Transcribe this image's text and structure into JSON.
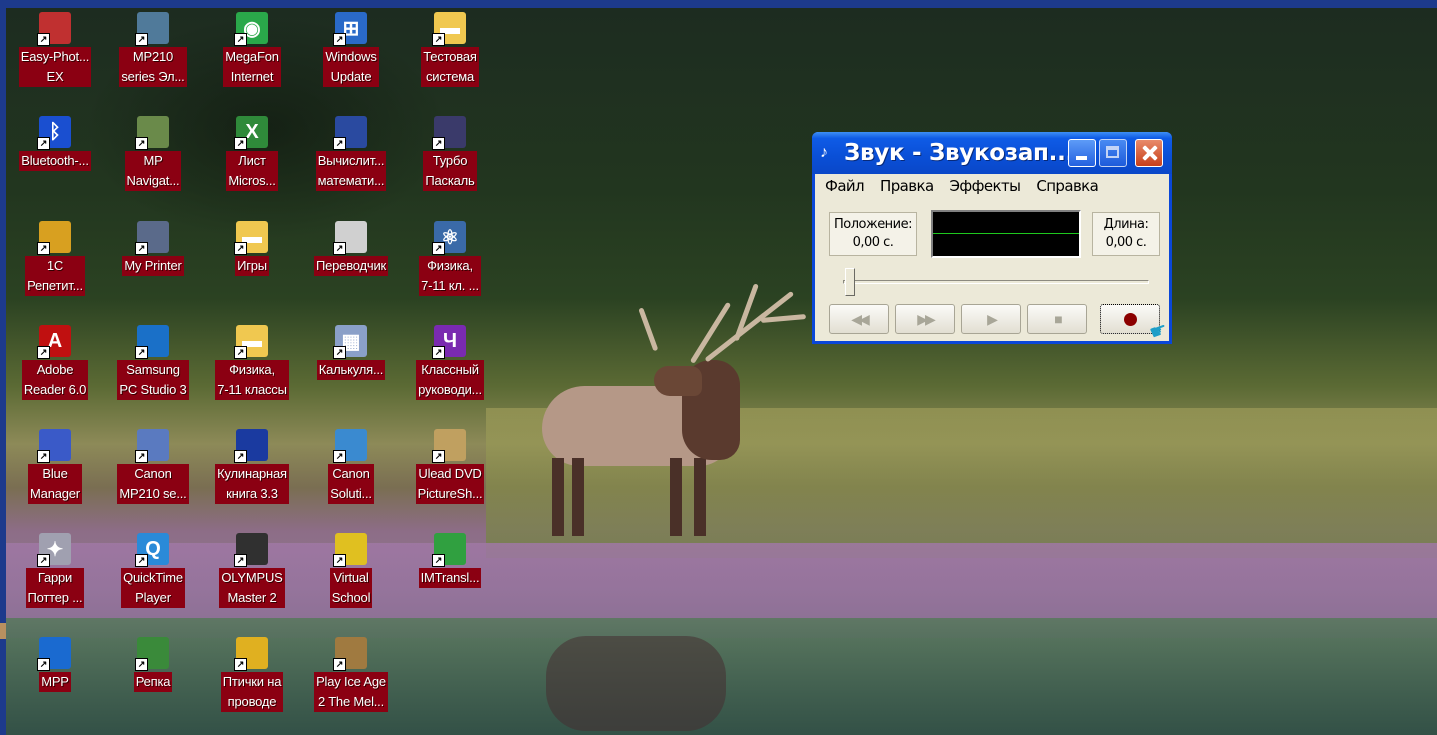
{
  "desktop_icons": [
    {
      "label": "Easy-Phot...\nEX",
      "icon": "camera-printer-icon",
      "color": "#c03030"
    },
    {
      "label": "MP210\nseries Эл...",
      "icon": "printer-manual-icon",
      "color": "#507a9a"
    },
    {
      "label": "MegaFon\nInternet",
      "icon": "megafon-icon",
      "color": "#2aa84a"
    },
    {
      "label": "Windows\nUpdate",
      "icon": "windows-update-icon",
      "color": "#2a6ac8"
    },
    {
      "label": "Тестовая\nсистема",
      "icon": "folder-icon",
      "color": "#f0c850"
    },
    {
      "label": "Bluetooth-...",
      "icon": "bluetooth-icon",
      "color": "#1a4fd0"
    },
    {
      "label": "MP\nNavigat...",
      "icon": "mp-navigator-icon",
      "color": "#6a8a4a"
    },
    {
      "label": "Лист\nMicros...",
      "icon": "excel-sheet-icon",
      "color": "#2f8a3a"
    },
    {
      "label": "Вычислит...\nматемати...",
      "icon": "math-calculator-icon",
      "color": "#2a4aa0"
    },
    {
      "label": "Турбо\nПаскаль",
      "icon": "turbo-pascal-icon",
      "color": "#3a3a6a"
    },
    {
      "label": "1С\nРепетит...",
      "icon": "1c-tutor-icon",
      "color": "#d8a020"
    },
    {
      "label": "My Printer",
      "icon": "my-printer-icon",
      "color": "#5a6a8a"
    },
    {
      "label": "Игры",
      "icon": "folder-icon",
      "color": "#f0c850"
    },
    {
      "label": "Переводчик",
      "icon": "translator-clock-icon",
      "color": "#d0d0d0"
    },
    {
      "label": "Физика,\n7-11 кл. ...",
      "icon": "atom-icon",
      "color": "#3a6aa8"
    },
    {
      "label": "Adobe\nReader 6.0",
      "icon": "adobe-reader-icon",
      "color": "#c01010"
    },
    {
      "label": "Samsung\nPC Studio 3",
      "icon": "samsung-pc-studio-icon",
      "color": "#1a70c8"
    },
    {
      "label": "Физика,\n7-11 классы",
      "icon": "folder-icon",
      "color": "#f0c850"
    },
    {
      "label": "Калькуля...",
      "icon": "calculator-icon",
      "color": "#8aa0c8"
    },
    {
      "label": "Классный\nруководи...",
      "icon": "class-teacher-icon",
      "color": "#7a2ab0"
    },
    {
      "label": "Blue\nManager",
      "icon": "bluetooth-manager-icon",
      "color": "#3a5ac8"
    },
    {
      "label": "Canon\nMP210 se...",
      "icon": "canon-mp210-icon",
      "color": "#5a7ac0"
    },
    {
      "label": "Кулинарная\nкнига 3.3",
      "icon": "cookbook-icon",
      "color": "#1a3aa0"
    },
    {
      "label": "Canon\nSoluti...",
      "icon": "canon-solution-icon",
      "color": "#3a8ad0"
    },
    {
      "label": "Ulead DVD\nPictureSh...",
      "icon": "ulead-dvd-icon",
      "color": "#c0a060"
    },
    {
      "label": "Гарри\nПоттер ...",
      "icon": "owl-icon",
      "color": "#a0a0b0"
    },
    {
      "label": "QuickTime\nPlayer",
      "icon": "quicktime-icon",
      "color": "#2a8ad8"
    },
    {
      "label": "OLYMPUS\nMaster 2",
      "icon": "olympus-camera-icon",
      "color": "#303030"
    },
    {
      "label": "Virtual\nSchool",
      "icon": "virtual-school-icon",
      "color": "#e0c020"
    },
    {
      "label": "IMTransl...",
      "icon": "imtranslator-icon",
      "color": "#30a040"
    },
    {
      "label": "MPP",
      "icon": "mpp-player-icon",
      "color": "#1a6ad0"
    },
    {
      "label": "Репка",
      "icon": "repka-icon",
      "color": "#3a8a3a"
    },
    {
      "label": "Птички на\nпроводе",
      "icon": "birds-icon",
      "color": "#e0b020"
    },
    {
      "label": "Play Ice Age\n2 The Mel...",
      "icon": "ice-age-icon",
      "color": "#a07a40"
    }
  ],
  "recorder": {
    "title": "Звук - Звукозап...",
    "menu": [
      "Файл",
      "Правка",
      "Эффекты",
      "Справка"
    ],
    "position_label": "Положение:",
    "position_value": "0,00 с.",
    "length_label": "Длина:",
    "length_value": "0,00 с.",
    "controls": [
      "seek-start",
      "seek-end",
      "play",
      "stop",
      "record"
    ],
    "position_fraction": 0.0
  }
}
